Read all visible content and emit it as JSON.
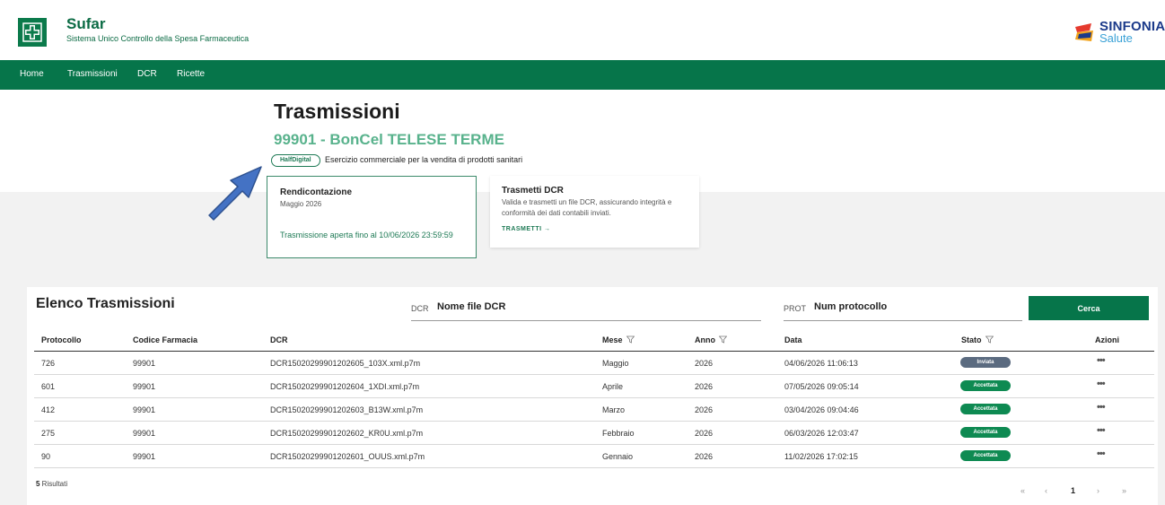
{
  "app": {
    "name": "Sufar",
    "subtitle": "Sistema Unico Controllo della Spesa Farmaceutica",
    "partner_name": "SINFONIA",
    "partner_sub": "Salute",
    "brand_color": "#06754a"
  },
  "nav": {
    "items": [
      {
        "label": "Home"
      },
      {
        "label": "Trasmissioni"
      },
      {
        "label": "DCR"
      },
      {
        "label": "Ricette"
      }
    ]
  },
  "header": {
    "title": "Trasmissioni",
    "pharmacy": "99901 - BonCel TELESE TERME",
    "badge": "HalfDigital",
    "description": "Esercizio commerciale per la vendita di prodotti sanitari"
  },
  "cards": {
    "rendicontazione": {
      "title": "Rendicontazione",
      "period": "Maggio 2026",
      "status": "Trasmissione aperta fino al 10/06/2026 23:59:59"
    },
    "trasmetti": {
      "title": "Trasmetti DCR",
      "description": "Valida e trasmetti un file DCR, assicurando integrità e conformità dei dati contabili inviati.",
      "link": "TRASMETTI →"
    }
  },
  "list": {
    "title": "Elenco Trasmissioni",
    "search_dcr_prefix": "DCR",
    "search_dcr_placeholder": "Nome file DCR",
    "search_prot_prefix": "PROT",
    "search_prot_placeholder": "Num protocollo",
    "search_button": "Cerca",
    "columns": {
      "protocollo": "Protocollo",
      "codice": "Codice Farmacia",
      "dcr": "DCR",
      "mese": "Mese",
      "anno": "Anno",
      "data": "Data",
      "stato": "Stato",
      "azioni": "Azioni"
    },
    "rows": [
      {
        "protocollo": "726",
        "codice": "99901",
        "dcr": "DCR15020299901202605_103X.xml.p7m",
        "mese": "Maggio",
        "anno": "2026",
        "data": "04/06/2026 11:06:13",
        "stato": "Inviata",
        "stato_color": "#5b6b80",
        "azioni": "•••"
      },
      {
        "protocollo": "601",
        "codice": "99901",
        "dcr": "DCR15020299901202604_1XDI.xml.p7m",
        "mese": "Aprile",
        "anno": "2026",
        "data": "07/05/2026 09:05:14",
        "stato": "Accettata",
        "stato_color": "#0e8a52",
        "azioni": "•••"
      },
      {
        "protocollo": "412",
        "codice": "99901",
        "dcr": "DCR15020299901202603_B13W.xml.p7m",
        "mese": "Marzo",
        "anno": "2026",
        "data": "03/04/2026 09:04:46",
        "stato": "Accettata",
        "stato_color": "#0e8a52",
        "azioni": "•••"
      },
      {
        "protocollo": "275",
        "codice": "99901",
        "dcr": "DCR15020299901202602_KR0U.xml.p7m",
        "mese": "Febbraio",
        "anno": "2026",
        "data": "06/03/2026 12:03:47",
        "stato": "Accettata",
        "stato_color": "#0e8a52",
        "azioni": "•••"
      },
      {
        "protocollo": "90",
        "codice": "99901",
        "dcr": "DCR15020299901202601_OUUS.xml.p7m",
        "mese": "Gennaio",
        "anno": "2026",
        "data": "11/02/2026 17:02:15",
        "stato": "Accettata",
        "stato_color": "#0e8a52",
        "azioni": "•••"
      }
    ],
    "results_count": "5",
    "results_label": " Risultati",
    "pagination": {
      "first": "«",
      "prev": "‹",
      "current": "1",
      "next": "›",
      "last": "»"
    }
  }
}
